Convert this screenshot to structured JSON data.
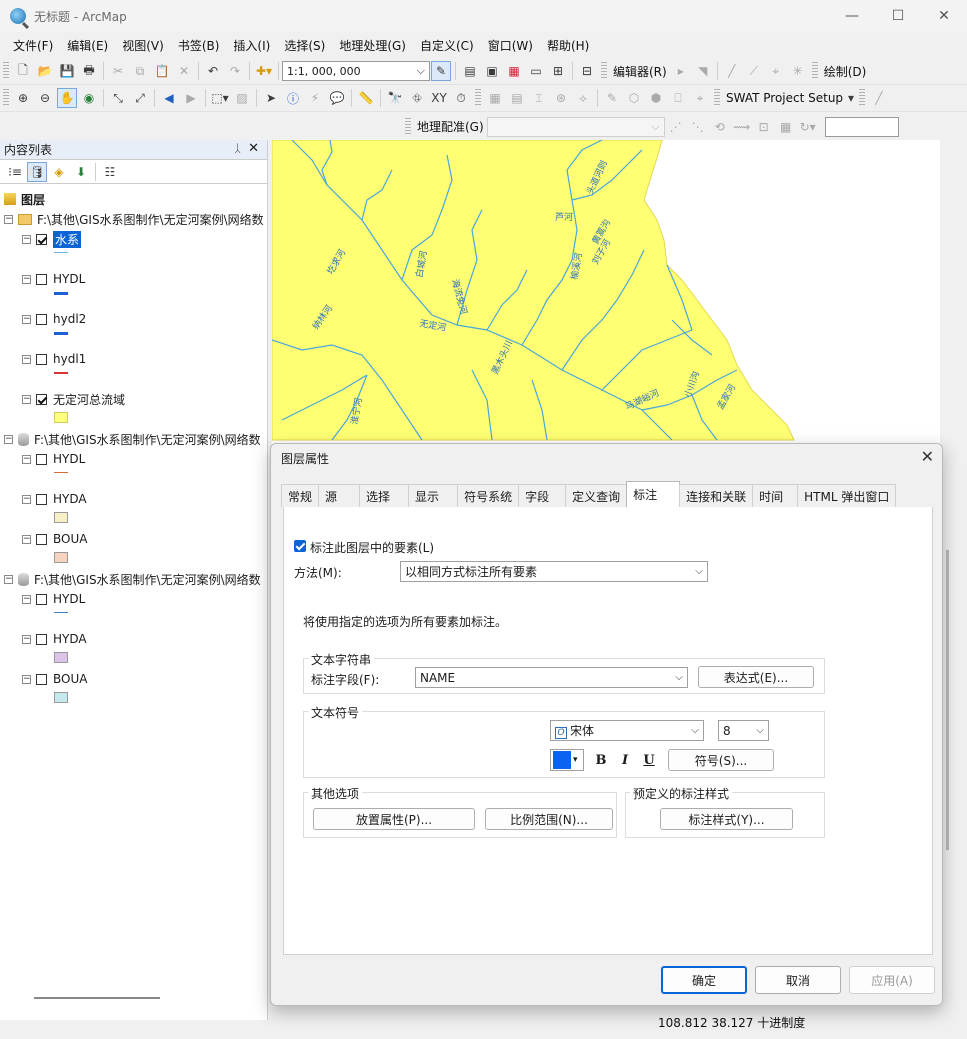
{
  "window": {
    "title": "无标题 - ArcMap",
    "min": "—",
    "max": "☐",
    "close": "✕"
  },
  "menu": [
    "文件(F)",
    "编辑(E)",
    "视图(V)",
    "书签(B)",
    "插入(I)",
    "选择(S)",
    "地理处理(G)",
    "自定义(C)",
    "窗口(W)",
    "帮助(H)"
  ],
  "toolbar": {
    "scale": "1:1, 000, 000",
    "editor": "编辑器(R)",
    "draw": "绘制(D)",
    "swat": "SWAT Project Setup",
    "georef": "地理配准(G)"
  },
  "toc": {
    "header": "内容列表",
    "pin": "ᛸ",
    "close": "✕",
    "root": "图层",
    "groups": [
      {
        "path": "F:\\其他\\GIS水系图制作\\无定河案例\\网络数",
        "layers": [
          {
            "name": "水系",
            "checked": true,
            "selected": true,
            "sym": "line",
            "color": "#5fb9e6"
          },
          {
            "name": "HYDL",
            "checked": false,
            "sym": "line",
            "color": "#1a5fd6"
          },
          {
            "name": "hydl2",
            "checked": false,
            "sym": "line",
            "color": "#1a5fd6"
          },
          {
            "name": "hydl1",
            "checked": false,
            "sym": "line",
            "color": "#d9343a"
          },
          {
            "name": "无定河总流域",
            "checked": true,
            "sym": "box",
            "color": "#ffff7f"
          }
        ]
      },
      {
        "path": "F:\\其他\\GIS水系图制作\\无定河案例\\网络数",
        "layers": [
          {
            "name": "HYDL",
            "checked": false,
            "sym": "line",
            "color": "#d56a3a"
          },
          {
            "name": "HYDA",
            "checked": false,
            "sym": "box",
            "color": "#f7f0c6"
          },
          {
            "name": "BOUA",
            "checked": false,
            "sym": "box",
            "color": "#f6d4c0"
          }
        ]
      },
      {
        "path": "F:\\其他\\GIS水系图制作\\无定河案例\\网络数",
        "layers": [
          {
            "name": "HYDL",
            "checked": false,
            "sym": "line",
            "color": "#3f7fc9"
          },
          {
            "name": "HYDA",
            "checked": false,
            "sym": "box",
            "color": "#dcc4e8"
          },
          {
            "name": "BOUA",
            "checked": false,
            "sym": "box",
            "color": "#c4e8ec"
          }
        ]
      }
    ]
  },
  "map": {
    "labels": [
      "头道河则",
      "芦河",
      "黄蒿沟",
      "刘子河",
      "榆溪河",
      "白城河",
      "海流兔河",
      "无定河",
      "纳林河",
      "黑木头川",
      "马湖峪河",
      "小川沟",
      "孟家河",
      "淮宁河",
      "圪求河"
    ]
  },
  "status": {
    "coords": "108.812  38.127 十进制度"
  },
  "dialog": {
    "title": "图层属性",
    "close": "✕",
    "tabs": [
      "常规",
      "源",
      "选择",
      "显示",
      "符号系统",
      "字段",
      "定义查询",
      "标注",
      "连接和关联",
      "时间",
      "HTML 弹出窗口"
    ],
    "active_tab": "标注",
    "label_features": "标注此图层中的要素(L)",
    "method_label": "方法(M):",
    "method_value": "以相同方式标注所有要素",
    "info": "将使用指定的选项为所有要素加标注。",
    "text_string_group": "文本字符串",
    "label_field_label": "标注字段(F):",
    "label_field_value": "NAME",
    "expression_btn": "表达式(E)...",
    "text_symbol_group": "文本符号",
    "font": "宋体",
    "font_size": "8",
    "font_color": "#0a64f0",
    "bold": "B",
    "italic": "I",
    "underline": "U",
    "symbol_btn": "符号(S)...",
    "other_group": "其他选项",
    "placement_btn": "放置属性(P)...",
    "scale_btn": "比例范围(N)...",
    "predefined_group": "预定义的标注样式",
    "style_btn": "标注样式(Y)...",
    "ok": "确定",
    "cancel": "取消",
    "apply": "应用(A)"
  }
}
